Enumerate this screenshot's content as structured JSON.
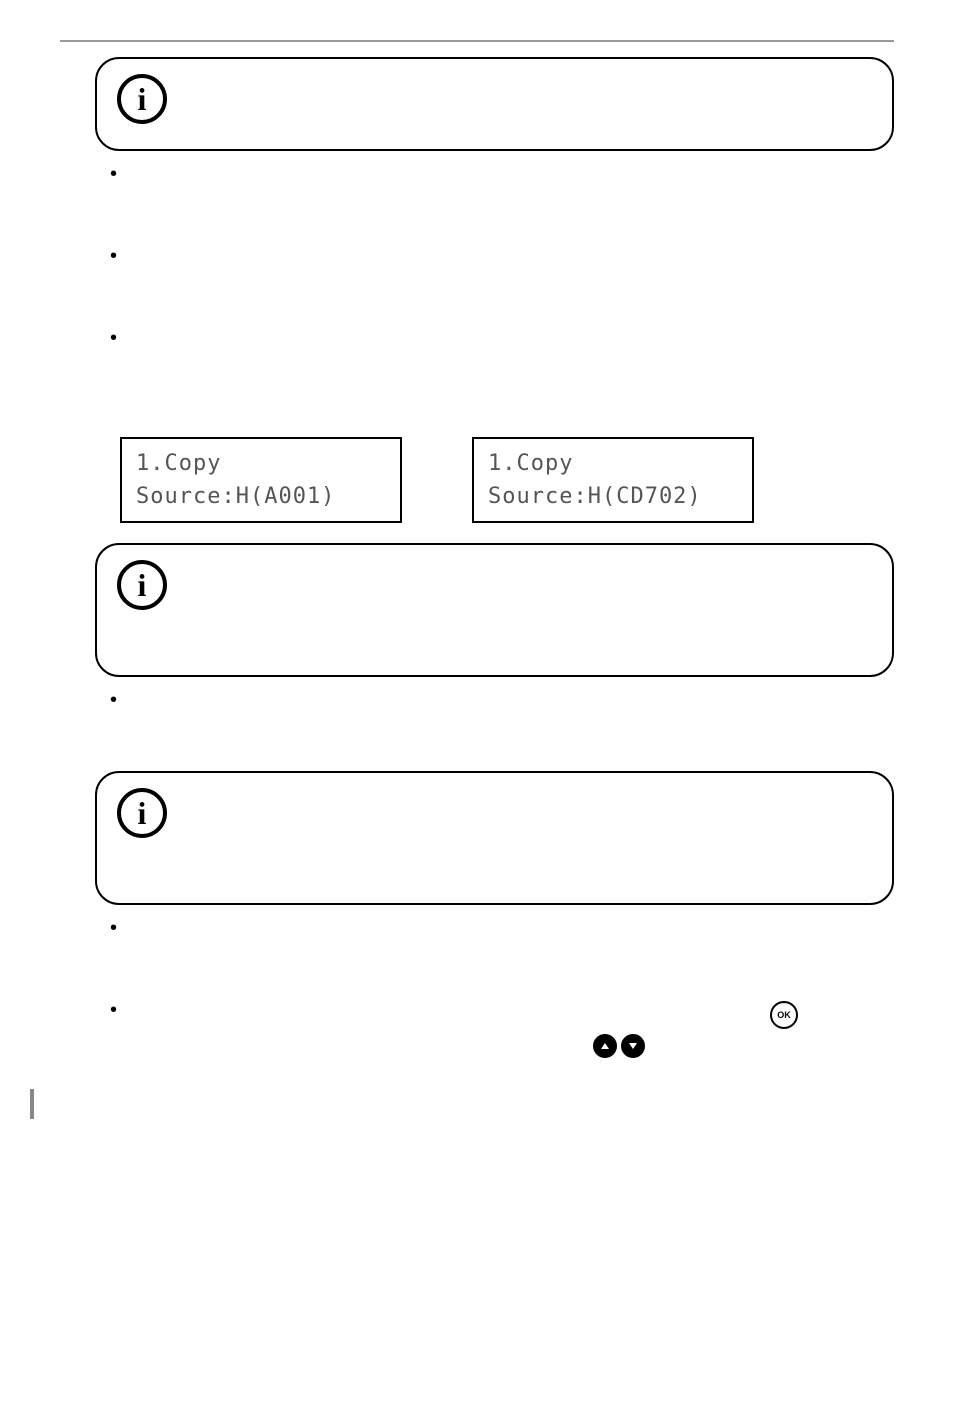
{
  "lcd": {
    "left": {
      "line1": "1.Copy",
      "line2": "Source:H(A001)"
    },
    "right": {
      "line1": "1.Copy",
      "line2": "Source:H(CD702)"
    }
  },
  "icons": {
    "info": "info-icon",
    "up": "up-arrow-icon",
    "down": "down-arrow-icon",
    "ok": "ok-button-icon"
  }
}
